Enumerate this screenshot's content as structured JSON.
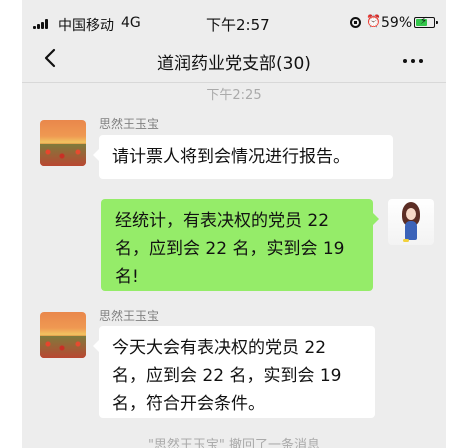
{
  "status_bar": {
    "carrier": "中国移动",
    "network": "4G",
    "time": "下午2:57",
    "battery_percent": "59%",
    "battery_level": 0.59,
    "battery_color": "#33c64b",
    "icons": [
      "signal-icon",
      "lock-rotation-icon",
      "alarm-icon",
      "battery-icon",
      "charging-icon"
    ]
  },
  "header": {
    "title": "道润药业党支部(30)",
    "back_icon": "back-arrow-icon",
    "more_icon": "more-icon"
  },
  "timestamp": "下午2:25",
  "messages": [
    {
      "side": "left",
      "sender": "思然王玉宝",
      "text": "请计票人将到会情况进行报告。"
    },
    {
      "side": "right",
      "text": "经统计，有表决权的党员 22 名，应到会 22 名，实到会 19 名!"
    },
    {
      "side": "left",
      "sender": "思然王玉宝",
      "text": "今天大会有表决权的党员 22 名，应到会 22 名，实到会 19 名，符合开会条件。"
    }
  ],
  "system_notice": "\"思然王玉宝\" 撤回了一条消息",
  "colors": {
    "chat_background": "#ededed",
    "incoming_bubble": "#ffffff",
    "outgoing_bubble": "#95ec69",
    "muted_text": "#aaaaaa"
  }
}
